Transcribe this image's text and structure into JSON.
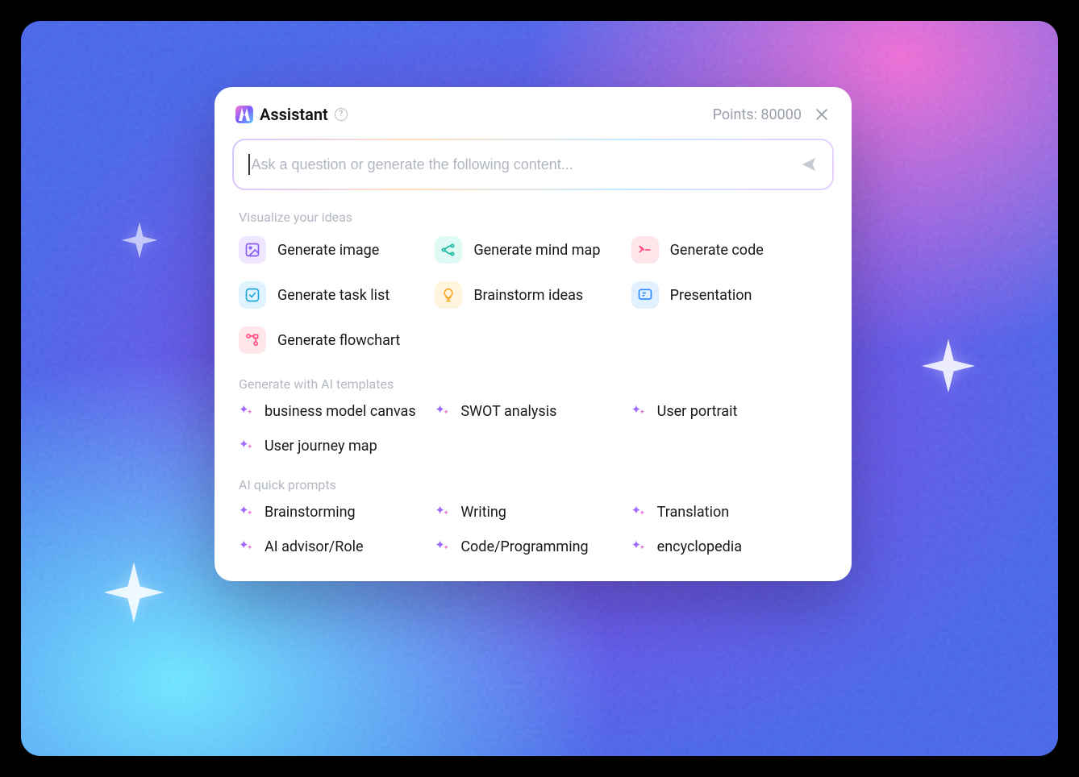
{
  "header": {
    "title": "Assistant",
    "points_label": "Points: 80000"
  },
  "input": {
    "placeholder": "Ask a question or generate the following content..."
  },
  "sections": {
    "visualize": {
      "title": "Visualize your ideas",
      "items": [
        {
          "label": "Generate image",
          "icon": "image-icon",
          "cls": "ic-purple"
        },
        {
          "label": "Generate mind map",
          "icon": "mindmap-icon",
          "cls": "ic-cyan"
        },
        {
          "label": "Generate code",
          "icon": "code-icon",
          "cls": "ic-pink"
        },
        {
          "label": "Generate task list",
          "icon": "checkbox-icon",
          "cls": "ic-cyan2"
        },
        {
          "label": "Brainstorm ideas",
          "icon": "lightbulb-icon",
          "cls": "ic-yellow"
        },
        {
          "label": "Presentation",
          "icon": "presentation-icon",
          "cls": "ic-blue"
        },
        {
          "label": "Generate flowchart",
          "icon": "flowchart-icon",
          "cls": "ic-pink"
        }
      ]
    },
    "templates": {
      "title": "Generate with AI templates",
      "items": [
        {
          "label": "business model canvas"
        },
        {
          "label": "SWOT analysis"
        },
        {
          "label": "User portrait"
        },
        {
          "label": "User journey map"
        }
      ]
    },
    "prompts": {
      "title": "AI quick prompts",
      "items": [
        {
          "label": "Brainstorming"
        },
        {
          "label": "Writing"
        },
        {
          "label": "Translation"
        },
        {
          "label": "AI advisor/Role"
        },
        {
          "label": "Code/Programming"
        },
        {
          "label": "encyclopedia"
        }
      ]
    }
  }
}
